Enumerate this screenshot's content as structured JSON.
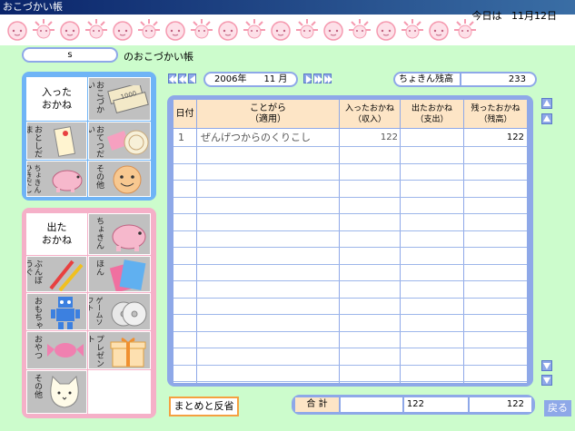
{
  "window": {
    "title": "おこづかい帳"
  },
  "header": {
    "today_label": "今日は",
    "today_date": "11月12日"
  },
  "account": {
    "name": "s",
    "name_suffix": "のおこづかい帳"
  },
  "income_panel": {
    "title": "入った\nおかね",
    "categories": [
      {
        "label": "おこづかい",
        "icon": "money-bills-icon"
      },
      {
        "label": "おとしだま",
        "icon": "otoshidama-envelope-icon"
      },
      {
        "label": "おてつだい",
        "icon": "dish-wash-icon"
      },
      {
        "label": "ちょきんひきだし",
        "icon": "piggy-bank-icon"
      },
      {
        "label": "その他",
        "icon": "smiley-face-icon"
      }
    ]
  },
  "expense_panel": {
    "title": "出た\nおかね",
    "categories": [
      {
        "label": "ちょきん",
        "icon": "piggy-bank-icon"
      },
      {
        "label": "ぶんぼうぐ",
        "icon": "pencils-icon"
      },
      {
        "label": "ほん",
        "icon": "books-icon"
      },
      {
        "label": "おもちゃ",
        "icon": "robot-icon"
      },
      {
        "label": "ゲームソフト",
        "icon": "game-discs-icon"
      },
      {
        "label": "おやつ",
        "icon": "candy-icon"
      },
      {
        "label": "プレゼント",
        "icon": "gift-box-icon"
      },
      {
        "label": "その他",
        "icon": "cat-face-icon"
      }
    ]
  },
  "month_nav": {
    "year": "2006年",
    "month": "11 月"
  },
  "savings": {
    "label": "ちょきん残高",
    "value": "233"
  },
  "ledger": {
    "headers": {
      "date": "日付",
      "desc_1": "ことがら",
      "desc_2": "（適用）",
      "income_1": "入ったおかね",
      "income_2": "（収入）",
      "expense_1": "出たおかね",
      "expense_2": "（支出）",
      "balance_1": "残ったおかね",
      "balance_2": "（残高）"
    },
    "rows": [
      {
        "date": "1",
        "description": "ぜんげつからのくりこし",
        "income": "122",
        "expense": "",
        "balance": "122"
      }
    ]
  },
  "summary_button": "まとめと反省",
  "totals": {
    "label": "合 計",
    "income": "122",
    "balance": "122"
  },
  "back_button": "戻る",
  "colors": {
    "background": "#ccfccc",
    "panel_blue": "#8ea8e8",
    "income_panel": "#6fb4f6",
    "expense_panel": "#f5b0c8",
    "header_cell": "#fde5c6"
  }
}
